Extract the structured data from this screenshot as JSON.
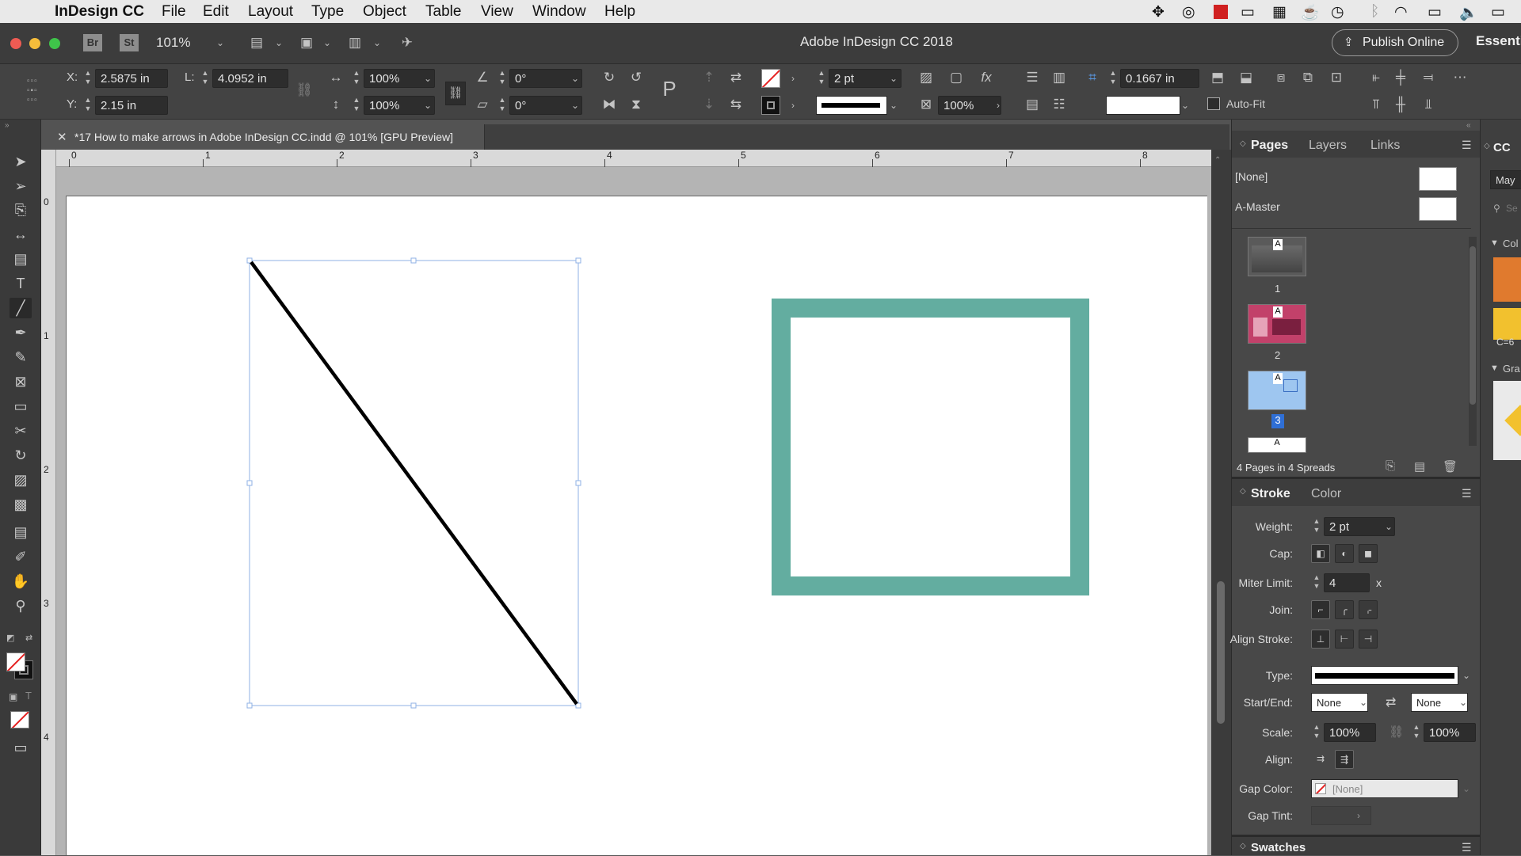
{
  "menubar": {
    "app": "InDesign CC",
    "items": [
      "File",
      "Edit",
      "Layout",
      "Type",
      "Object",
      "Table",
      "View",
      "Window",
      "Help"
    ]
  },
  "titlebar": {
    "bridge": "Br",
    "stock": "St",
    "zoom": "101%",
    "title": "Adobe InDesign CC 2018",
    "publish": "Publish Online",
    "workspace": "Essenti"
  },
  "control": {
    "x_label": "X:",
    "x_value": "2.5875 in",
    "y_label": "Y:",
    "y_value": "2.15 in",
    "l_label": "L:",
    "l_value": "4.0952 in",
    "scale_x": "100%",
    "scale_y": "100%",
    "angle": "0°",
    "shear": "0°",
    "stroke_weight": "2 pt",
    "opacity": "100%",
    "offset": "0.1667 in",
    "autofit": "Auto-Fit"
  },
  "doc_tab": {
    "title": "*17 How to make arrows in Adobe InDesign CC.indd @ 101% [GPU Preview]"
  },
  "rulers": {
    "top": [
      "0",
      "1",
      "2",
      "3",
      "4",
      "5",
      "6",
      "7",
      "8"
    ],
    "left": [
      "0",
      "1",
      "2",
      "3",
      "4"
    ]
  },
  "pages_panel": {
    "tabs": [
      "Pages",
      "Layers",
      "Links"
    ],
    "none_label": "[None]",
    "master_label": "A-Master",
    "pages": [
      {
        "num": "1",
        "master": "A"
      },
      {
        "num": "2",
        "master": "A"
      },
      {
        "num": "3",
        "master": "A"
      },
      {
        "num": "",
        "master": "A"
      }
    ],
    "footer": "4 Pages in 4 Spreads"
  },
  "stroke_panel": {
    "tabs": [
      "Stroke",
      "Color"
    ],
    "weight_label": "Weight:",
    "weight": "2 pt",
    "cap_label": "Cap:",
    "miter_label": "Miter Limit:",
    "miter": "4",
    "miter_unit": "x",
    "join_label": "Join:",
    "align_stroke_label": "Align Stroke:",
    "type_label": "Type:",
    "start_end_label": "Start/End:",
    "start": "None",
    "end": "None",
    "scale_label": "Scale:",
    "scale_start": "100%",
    "scale_end": "100%",
    "align_label": "Align:",
    "gap_color_label": "Gap Color:",
    "gap_color": "[None]",
    "gap_tint_label": "Gap Tint:"
  },
  "swatches_panel": {
    "title": "Swatches"
  },
  "far_panel": {
    "cc": "CC",
    "may": "May",
    "se": "Se",
    "col": "Col",
    "c6": "C=6",
    "gra": "Gra"
  },
  "colors": {
    "teal_frame": "#63ada0",
    "accent_orange": "#e07a2e",
    "accent_yellow": "#f2c12e",
    "selection_blue": "#8fb2e6"
  }
}
